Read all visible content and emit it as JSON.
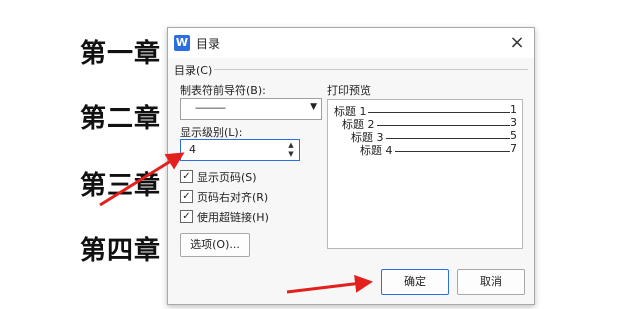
{
  "chapters": [
    "第一章",
    "第二章",
    "第三章",
    "第四章"
  ],
  "dialog": {
    "app_icon": "W",
    "title": "目录",
    "close_icon": "×",
    "section_label": "目录(C)",
    "tab_leader_label": "制表符前导符(B):",
    "tab_leader_value": "———",
    "display_level_label": "显示级别(L):",
    "display_level_value": "4",
    "checkboxes": [
      {
        "label": "显示页码(S)",
        "checked": true
      },
      {
        "label": "页码右对齐(R)",
        "checked": true
      },
      {
        "label": "使用超链接(H)",
        "checked": true
      }
    ],
    "options_button": "选项(O)...",
    "preview_label": "打印预览",
    "preview": [
      {
        "text": "标题 1",
        "page": "1"
      },
      {
        "text": "标题 2",
        "page": "3"
      },
      {
        "text": "标题 3",
        "page": "5"
      },
      {
        "text": "标题 4",
        "page": "7"
      }
    ],
    "ok_button": "确定",
    "cancel_button": "取消"
  },
  "colors": {
    "accent": "#2c6ee0",
    "arrow": "#e3201b"
  }
}
